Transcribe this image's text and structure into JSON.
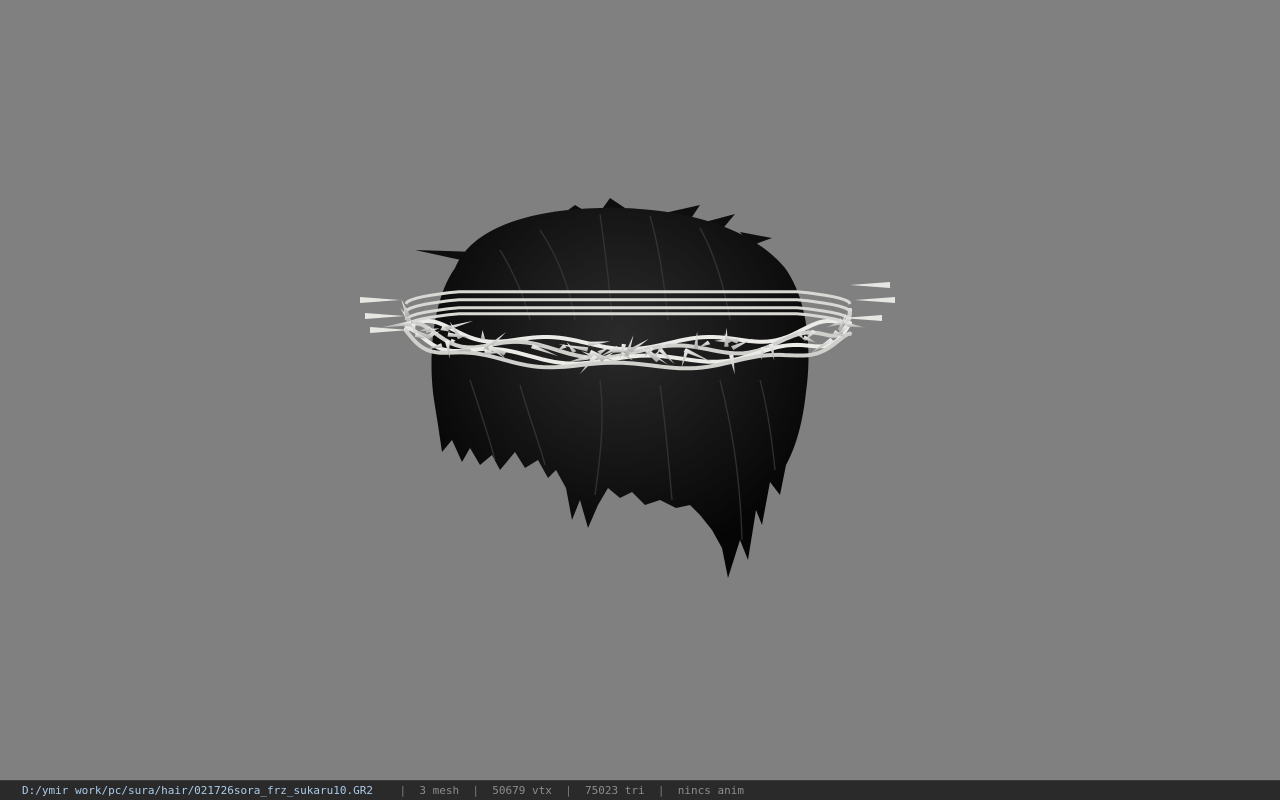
{
  "viewport": {
    "background_color": "#808080",
    "model": "hair-with-crown-of-thorns"
  },
  "status_bar": {
    "file_path": "D:/ymir work/pc/sura/hair/021726sora_frz_sukaru10.GR2",
    "separator": "|",
    "mesh_count": "3 mesh",
    "vertex_count": "50679 vtx",
    "triangle_count": "75023 tri",
    "anim_status": "nincs anim",
    "path_color": "#a9c9e8",
    "text_color": "#8c8c8c"
  }
}
